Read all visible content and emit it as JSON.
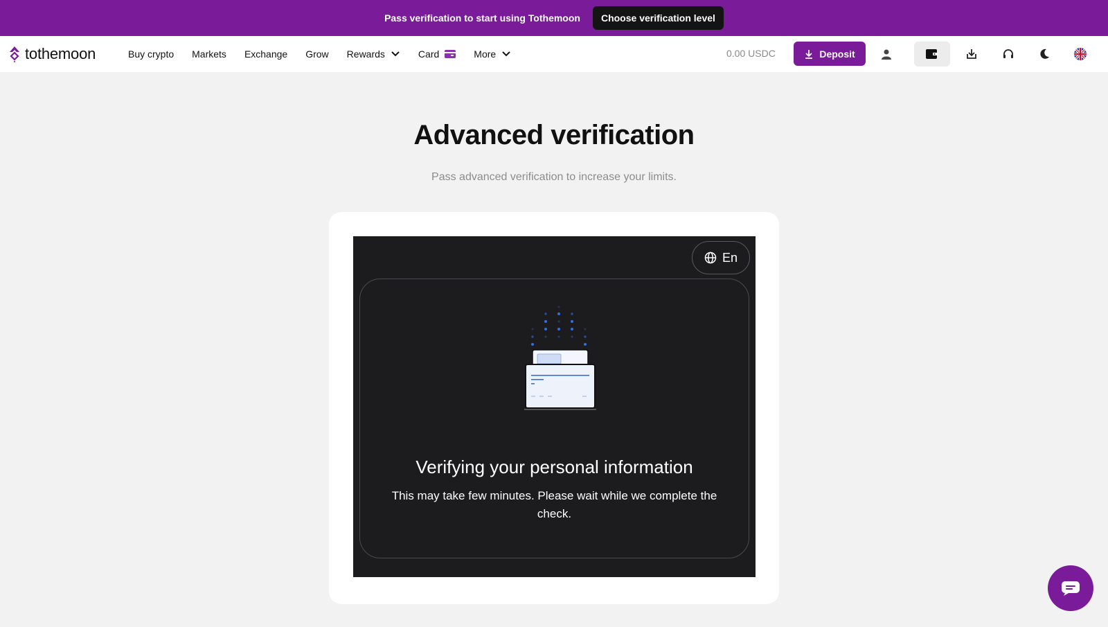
{
  "promo": {
    "text": "Pass verification to start using Tothemoon",
    "button": "Choose verification level"
  },
  "nav": {
    "logo": "tothemoon",
    "items": [
      {
        "label": "Buy crypto"
      },
      {
        "label": "Markets"
      },
      {
        "label": "Exchange"
      },
      {
        "label": "Grow"
      },
      {
        "label": "Rewards"
      },
      {
        "label": "Card"
      },
      {
        "label": "More"
      }
    ],
    "balance": "0.00 USDC",
    "deposit": "Deposit",
    "icons": [
      "user-icon",
      "wallet-icon",
      "download-icon",
      "headset-icon",
      "moon-icon",
      "uk-flag-icon"
    ]
  },
  "main": {
    "title": "Advanced verification",
    "subtitle": "Pass advanced verification to increase your limits."
  },
  "widget": {
    "lang": "En",
    "status_title": "Verifying your personal information",
    "status_text": "This may take few minutes. Please wait while we complete the check."
  },
  "colors": {
    "brand": "#7a1b9a",
    "widget_bg": "#1c1c1f",
    "accent_blue": "#2f6fe8"
  }
}
